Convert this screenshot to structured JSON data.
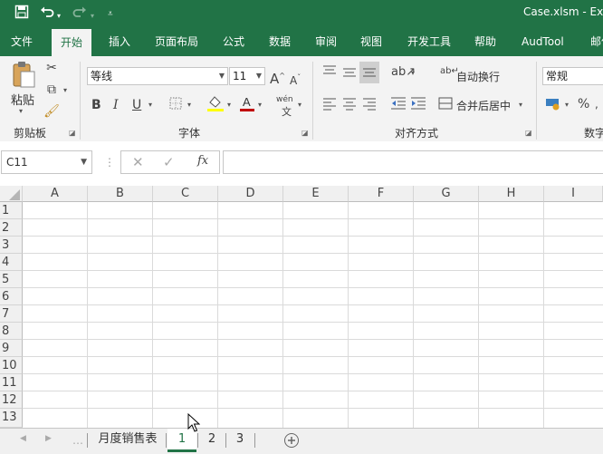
{
  "titlebar": {
    "title": "Case.xlsm  -  Ex",
    "icons": [
      "save-icon",
      "undo-icon",
      "redo-icon",
      "customize-qat-icon"
    ]
  },
  "tabs": [
    "文件",
    "开始",
    "插入",
    "页面布局",
    "公式",
    "数据",
    "审阅",
    "视图",
    "开发工具",
    "帮助",
    "AudTool",
    "邮件"
  ],
  "active_tab": "开始",
  "ribbon": {
    "clipboard": {
      "paste_label": "粘贴",
      "group_label": "剪贴板"
    },
    "font": {
      "font_name": "等线",
      "font_size": "11",
      "group_label": "字体",
      "phonetic_label": "wén"
    },
    "alignment": {
      "wrap_text": "自动换行",
      "merge_center": "合并后居中",
      "group_label": "对齐方式"
    },
    "number": {
      "format": "常规",
      "percent": "%",
      "group_label": "数字"
    }
  },
  "formula_bar": {
    "name_box": "C11",
    "fx_label": "fx",
    "formula": ""
  },
  "columns": [
    "A",
    "B",
    "C",
    "D",
    "E",
    "F",
    "G",
    "H",
    "I"
  ],
  "rows": [
    "1",
    "2",
    "3",
    "4",
    "5",
    "6",
    "7",
    "8",
    "9",
    "10",
    "11",
    "12",
    "13"
  ],
  "sheets": [
    "月度销售表",
    "1",
    "2",
    "3"
  ],
  "active_sheet": "1",
  "colors": {
    "accent": "#217346",
    "font_color": "#c00000",
    "fill_color": "#ffff00"
  }
}
